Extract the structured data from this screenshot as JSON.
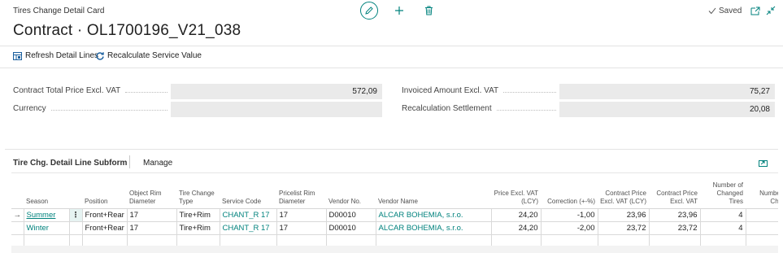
{
  "header": {
    "caption": "Tires Change Detail Card",
    "title": "Contract · OL1700196_V21_038",
    "saved_label": "Saved",
    "icons": {
      "edit": "pencil-icon",
      "add": "plus-icon",
      "delete": "trash-icon",
      "saved": "check-icon",
      "popout": "open-new-window-icon",
      "collapse": "collapse-icon"
    }
  },
  "actions": {
    "refresh_label": "Refresh Detail Lines",
    "recalc_label": "Recalculate Service Value"
  },
  "fields": {
    "contract_total_label": "Contract Total Price Excl. VAT",
    "contract_total_value": "572,09",
    "currency_label": "Currency",
    "currency_value": "",
    "invoiced_label": "Invoiced Amount Excl. VAT",
    "invoiced_value": "75,27",
    "recalc_label": "Recalculation Settlement",
    "recalc_value": "20,08"
  },
  "subform": {
    "title": "Tire Chg. Detail Line Subform",
    "manage_label": "Manage",
    "columns": {
      "season": "Season",
      "position": "Position",
      "object_rim": "Object Rim Diameter",
      "tire_change_type": "Tire Change Type",
      "service_code": "Service Code",
      "pricelist_rim": "Pricelist Rim Diameter",
      "vendor_no": "Vendor No.",
      "vendor_name": "Vendor Name",
      "price_excl_vat": "Price Excl. VAT (LCY)",
      "correction": "Correction (+-%)",
      "contract_price_lcy": "Contract Price Excl. VAT (LCY)",
      "contract_price": "Contract Price Excl. VAT",
      "number_changed": "Number of Changed Tires",
      "number_ti": "Number Ti Chang"
    },
    "rows": [
      {
        "marker": "→",
        "menu": "⋮",
        "season": "Summer",
        "position": "Front+Rear",
        "object_rim": "17",
        "tire_change_type": "Tire+Rim",
        "service_code": "CHANT_R 17",
        "pricelist_rim": "17",
        "vendor_no": "D00010",
        "vendor_name": "ALCAR BOHEMIA, s.r.o.",
        "price_excl_vat": "24,20",
        "correction": "-1,00",
        "contract_price_lcy": "23,96",
        "contract_price": "23,96",
        "number_changed": "4"
      },
      {
        "marker": "",
        "menu": "",
        "season": "Winter",
        "position": "Front+Rear",
        "object_rim": "17",
        "tire_change_type": "Tire+Rim",
        "service_code": "CHANT_R 17",
        "pricelist_rim": "17",
        "vendor_no": "D00010",
        "vendor_name": "ALCAR BOHEMIA, s.r.o.",
        "price_excl_vat": "24,20",
        "correction": "-2,00",
        "contract_price_lcy": "23,72",
        "contract_price": "23,72",
        "number_changed": "4"
      }
    ]
  },
  "colors": {
    "accent": "#00827d",
    "field_bg": "#eaeaea",
    "selected_cell": "#e6f3f2"
  }
}
